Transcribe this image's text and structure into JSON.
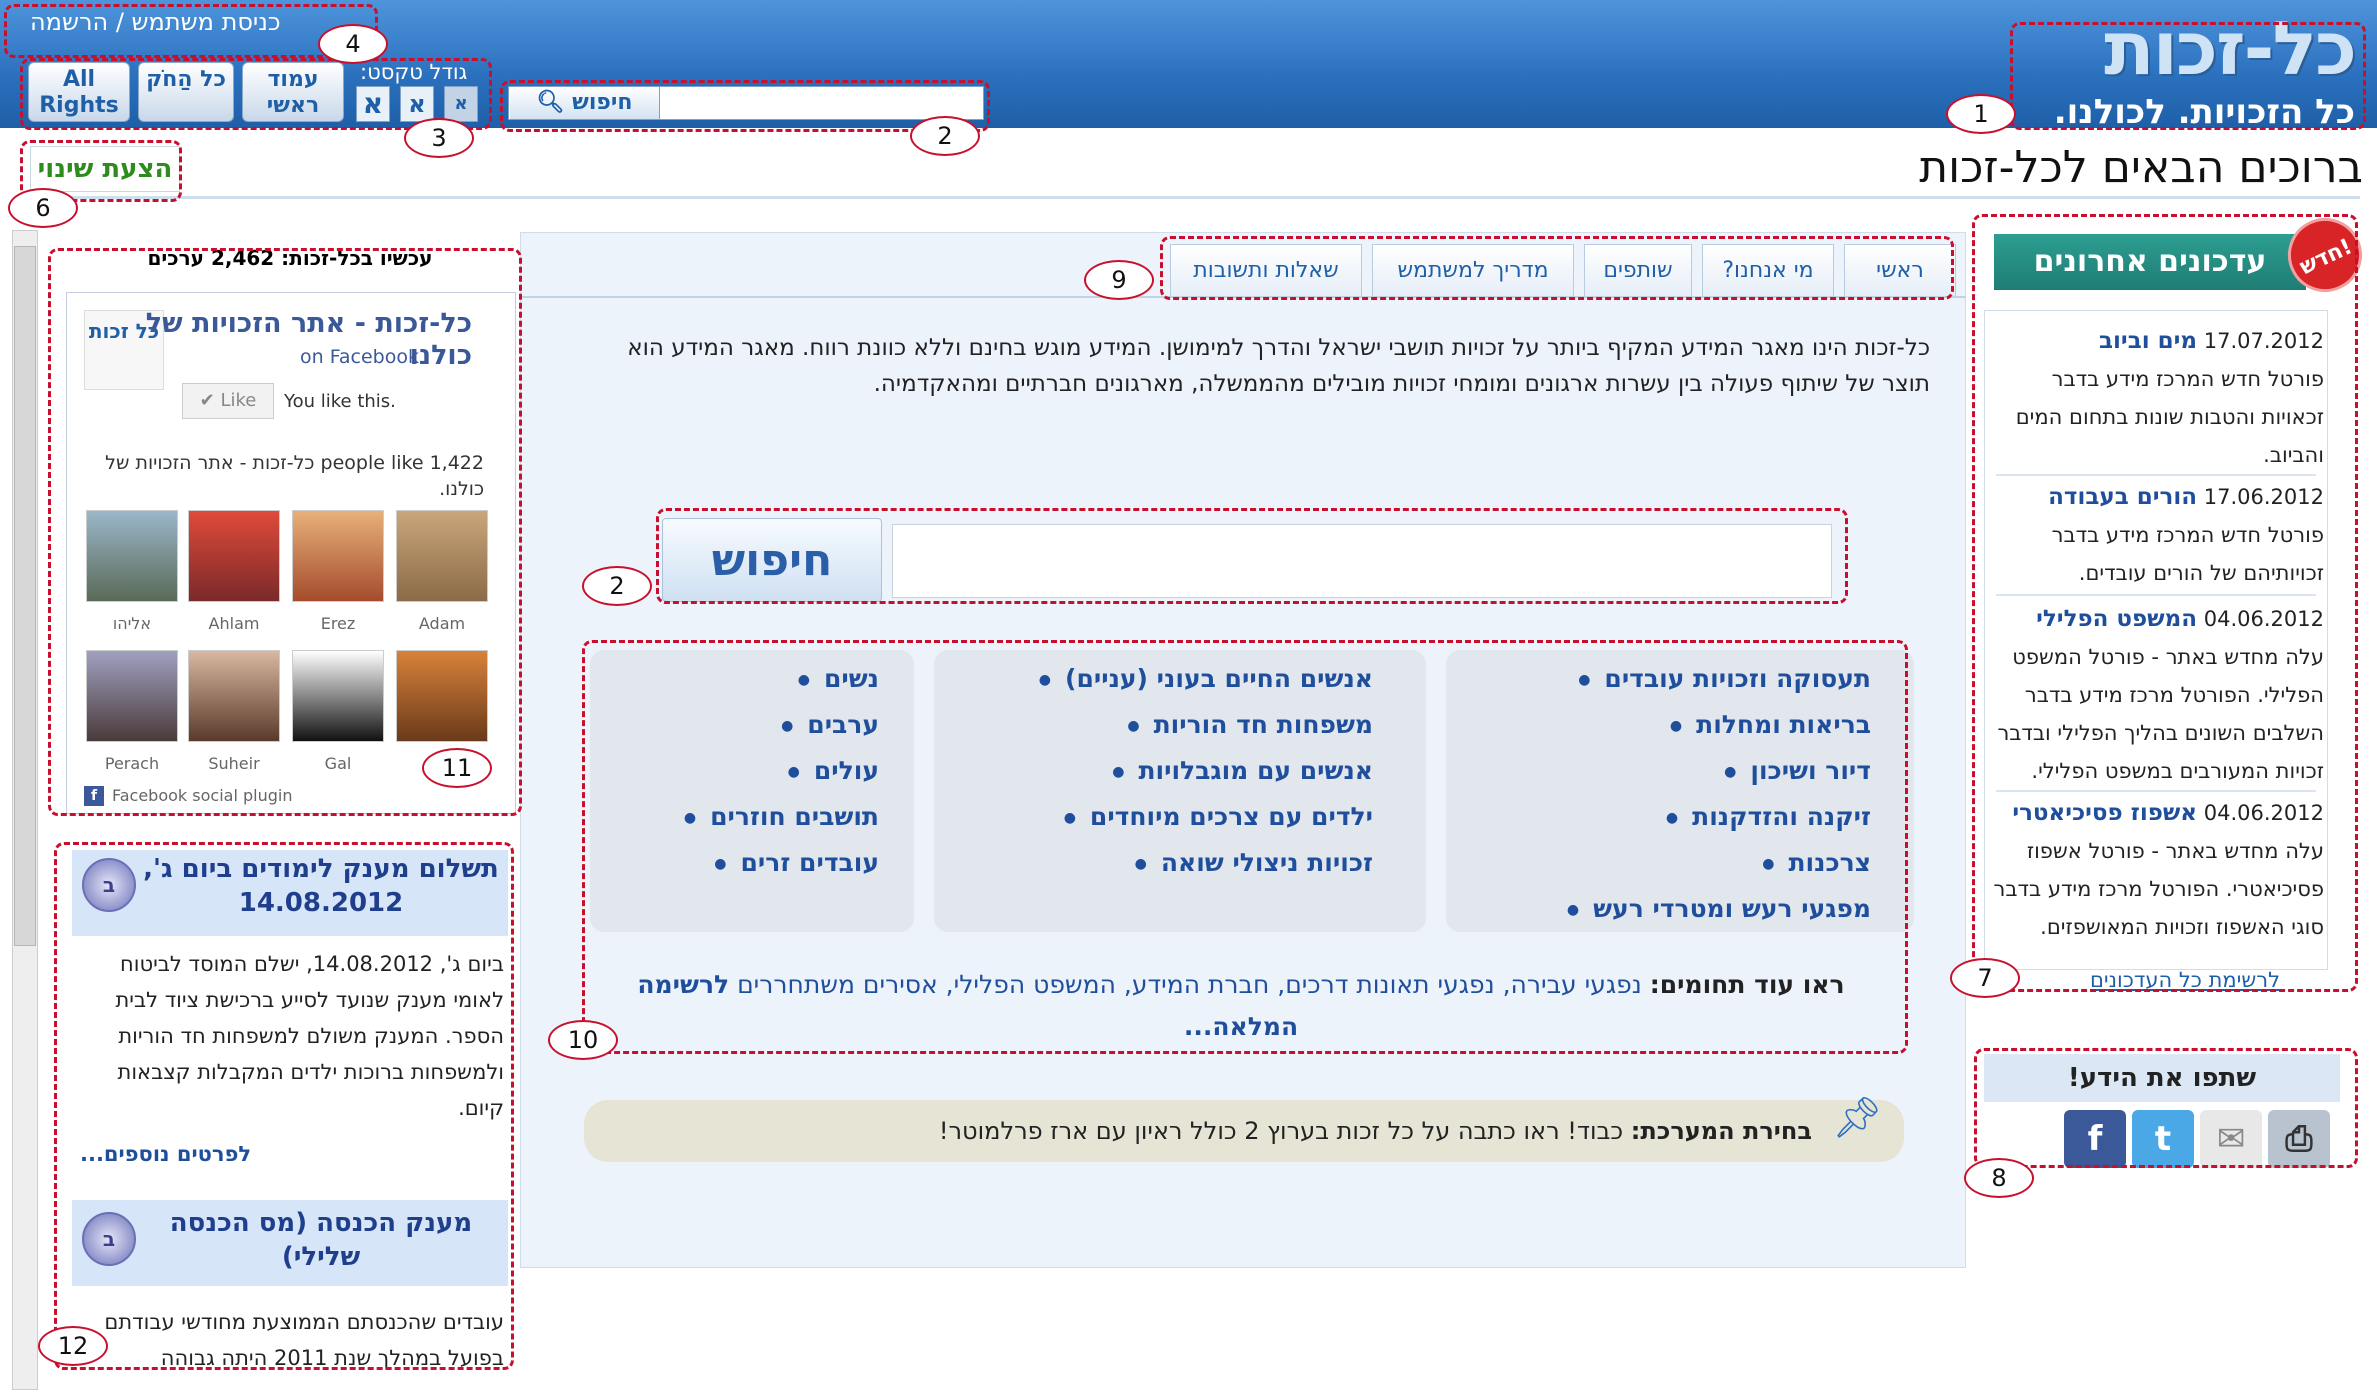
{
  "header": {
    "logo_text": "כל-זכות",
    "slogan": "כל הזכויות. לכולנו.",
    "login_link": "כניסת משתמש / הרשמה",
    "buttons": [
      {
        "label": "All Rights"
      },
      {
        "label": "כל הַחֹק"
      },
      {
        "label": "עמוד ראשי"
      }
    ],
    "font_size_label": "גודל טקסט:",
    "font_sizes": [
      "א",
      "א",
      "א"
    ],
    "search_button": "חיפוש"
  },
  "title_bar": {
    "page_title": "ברוכים הבאים לכל-זכות",
    "propose_change": "הצעת שינוי"
  },
  "left": {
    "count_line": "עכשיו בכל-זכות: 2,462 ערכים",
    "facebook": {
      "title": "כל-זכות - אתר הזכויות של כולנו",
      "on_facebook": "on Facebook",
      "like": "Like",
      "you_like": "You like this.",
      "people_like": "1,422 people like כל-זכות - אתר הזכויות של כולנו.",
      "logo_text": "כל זכות",
      "faces": [
        {
          "name": "Adam"
        },
        {
          "name": "Erez"
        },
        {
          "name": "Ahlam"
        },
        {
          "name": "אליהו"
        },
        {
          "name": "Gal"
        },
        {
          "name": "Suheir"
        },
        {
          "name": "Perach"
        },
        {
          "name": ""
        }
      ],
      "plugin_label": "Facebook social plugin"
    },
    "news": [
      {
        "title": "תשלום מענק לימודים ביום ג', 14.08.2012",
        "body": "ביום ג', 14.08.2012, ישלם המוסד לביטוח לאומי מענק שנועד לסייע ברכישת ציוד לבית הספר. המענק משולם למשפחות חד הוריות ולמשפחות ברוכות ילדים המקבלות קצבאות קיום.",
        "more": "לפרטים נוספים..."
      },
      {
        "title": "מענק הכנסה (מס הכנסה שלילי)",
        "body": "עובדים שהכנסתם הממוצעת מחודשי עבודתם בפועל במהלך שנת 2011 היתה גבוהה"
      }
    ]
  },
  "center": {
    "tabs": [
      "ראשי",
      "מי אנחנו?",
      "שותפים",
      "מדריך למשתמש",
      "שאלות ותשובות"
    ],
    "intro": "כל-זכות הינו מאגר המידע המקיף ביותר על זכויות תושבי ישראל והדרך למימושן. המידע מוגש בחינם וללא כוונת רווח. מאגר המידע הוא תוצר של שיתוף פעולה בין עשרות ארגונים ומומחי זכויות מובילים מהממשלה, מארגונים חברתיים ומהאקדמיה.",
    "search_button": "חיפוש",
    "categories": [
      [
        "תעסוקה וזכויות עובדים",
        "בריאות ומחלות",
        "דיור ושיכון",
        "זיקנה והזדקנות",
        "צרכנות",
        "מפגעי רעש ומטרדי רעש"
      ],
      [
        "אנשים החיים בעוני (עניים)",
        "משפחות חד הוריות",
        "אנשים עם מוגבלויות",
        "ילדים עם צרכים מיוחדים",
        "זכויות ניצולי שואה"
      ],
      [
        "נשים",
        "ערבים",
        "עולים",
        "תושבים חוזרים",
        "עובדים זרים"
      ]
    ],
    "more_areas_label": "ראו עוד תחומים:",
    "more_areas": "נפגעי עבירה, נפגעי תאונות דרכים, חברת המידע, המשפט הפלילי, אסירים משתחררים",
    "full_list": "לרשימה המלאה...",
    "editor_pick_label": "בחירת המערכת:",
    "editor_pick_text": "כבוד! ראו כתבה על כל זכות בערוץ 2 כולל ראיון עם ארז פרלמוטר!"
  },
  "right": {
    "new_badge": "חדש!",
    "updates_title": "עדכונים אחרונים",
    "updates": [
      {
        "date": "17.07.2012",
        "title": "מים וביוב",
        "text": "פורטל חדש המרכז מידע בדבר זכאויות והטבות שונות בתחום המים והביוב."
      },
      {
        "date": "17.06.2012",
        "title": "הורים בעבודה",
        "text": "פורטל חדש המרכז מידע בדבר זכויותיהם של הורים עובדים."
      },
      {
        "date": "04.06.2012",
        "title": "המשפט הפלילי",
        "text": "עלה מחדש באתר - פורטל המשפט הפלילי. הפורטל מרכז מידע בדבר השלבים השונים בהליך הפלילי ובדבר זכויות המעורבים במשפט הפלילי."
      },
      {
        "date": "04.06.2012",
        "title": "אשפוז פסיכיאטרי",
        "text": "עלה מחדש באתר - פורטל אשפוז פסיכיאטרי. הפורטל מרכז מידע בדבר סוגי האשפוז וזכויות המאושפזים."
      }
    ],
    "updates_more": "לרשימת כל העדכונים",
    "share_title": "שתפו את הידע!"
  },
  "annotations": [
    "1",
    "2",
    "3",
    "4",
    "2",
    "6",
    "7",
    "8",
    "9",
    "10",
    "11",
    "12"
  ]
}
